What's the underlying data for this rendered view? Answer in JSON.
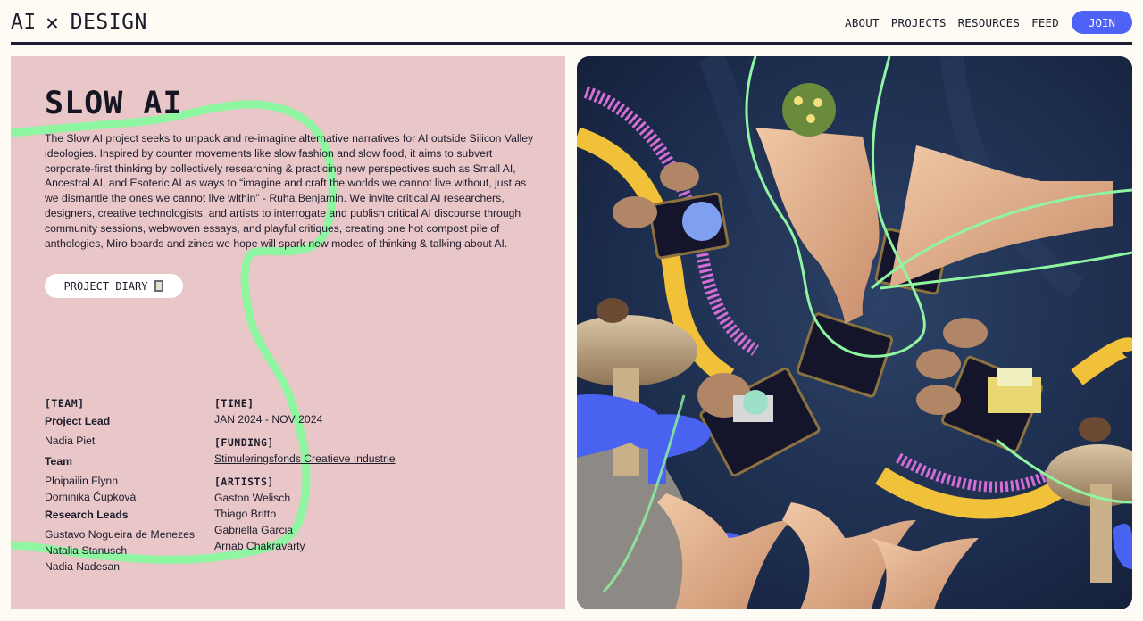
{
  "header": {
    "logo_left": "AI",
    "logo_right": "DESIGN",
    "logo_icon": "x-mark-icon",
    "nav": [
      "ABOUT",
      "PROJECTS",
      "RESOURCES",
      "FEED"
    ],
    "join_label": "JOIN"
  },
  "colors": {
    "background": "#fdfbf3",
    "panel_pink": "#e9c7c8",
    "squiggle_green": "#8ef5a0",
    "accent_blue": "#4e63f5",
    "navy_line": "#1c1d33"
  },
  "project": {
    "title": "SLOW AI",
    "description": "The Slow AI project seeks to unpack and re-imagine alternative narratives for AI outside Silicon Valley ideologies. Inspired by counter movements like slow fashion and slow food, it aims to subvert corporate-first thinking by collectively researching & practicing new perspectives such as Small AI, Ancestral AI, and Esoteric AI as ways to “imagine and craft the worlds we cannot live without, just as we dismantle the ones we cannot live within” - Ruha Benjamin. We invite critical AI researchers, designers, creative technologists, and artists to interrogate and publish critical AI discourse through community sessions, webwoven essays, and playful critiques, creating one hot compost pile of anthologies, Miro boards and zines we hope will spark new modes of thinking & talking about AI.",
    "diary_button": "PROJECT DIARY",
    "diary_icon": "book-icon"
  },
  "team": {
    "label": "[TEAM]",
    "project_lead_label": "Project Lead",
    "project_lead": [
      "Nadia Piet"
    ],
    "team_label": "Team",
    "team_members": [
      "Ploipailin Flynn",
      "Dominika Čupková"
    ],
    "research_leads_label": "Research Leads",
    "research_leads": [
      "Gustavo Nogueira de Menezes",
      "Natalia Stanusch",
      "Nadia Nadesan"
    ]
  },
  "time": {
    "label": "[TIME]",
    "value": "JAN 2024 - NOV 2024"
  },
  "funding": {
    "label": "[FUNDING]",
    "value": "Stimuleringsfonds Creatieve Industrie"
  },
  "artists": {
    "label": "[ARTISTS]",
    "names": [
      "Gaston Welisch",
      "Thiago Britto",
      "Gabriella Garcia",
      "Arnab Chakravarty"
    ]
  },
  "image": {
    "name": "collage-image"
  }
}
